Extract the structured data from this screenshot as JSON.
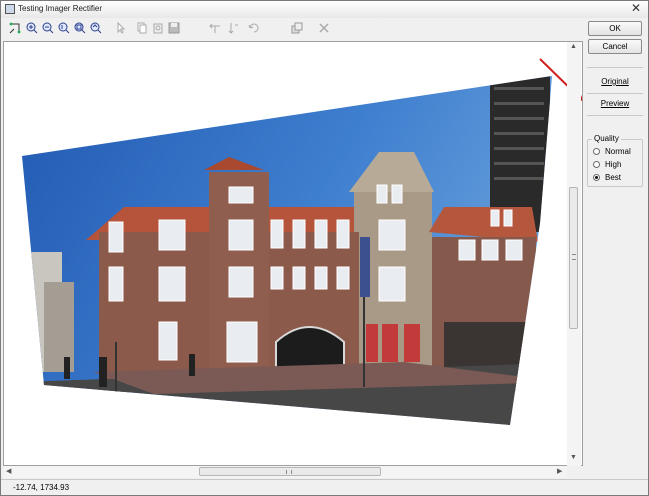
{
  "window": {
    "title": "Testing Imager Rectifier",
    "close_glyph": "✕"
  },
  "toolbar": {
    "tools": [
      {
        "icon": "rectify-pointer-icon"
      },
      {
        "icon": "zoom-in-icon"
      },
      {
        "icon": "zoom-out-icon"
      },
      {
        "icon": "zoom-actual-icon"
      },
      {
        "icon": "zoom-fit-icon"
      },
      {
        "icon": "zoom-selection-icon"
      },
      {
        "icon": "select-arrow-icon"
      },
      {
        "icon": "copy-icon"
      },
      {
        "icon": "paste-icon"
      },
      {
        "icon": "save-icon"
      },
      {
        "icon": "flip-horizontal-icon"
      },
      {
        "icon": "flip-vertical-icon"
      },
      {
        "icon": "rotate-icon"
      },
      {
        "icon": "properties-icon"
      },
      {
        "icon": "delete-icon"
      }
    ]
  },
  "panel": {
    "ok_label": "OK",
    "cancel_label": "Cancel",
    "original_label": "Original",
    "preview_label": "Preview",
    "quality_legend": "Quality",
    "quality_options": [
      {
        "label": "Normal",
        "selected": false
      },
      {
        "label": "High",
        "selected": false
      },
      {
        "label": "Best",
        "selected": true
      }
    ]
  },
  "status": {
    "coords": "-12.74,   1734.93"
  },
  "colors": {
    "annotation_arrow": "#d02020",
    "sky": "#2b63b8",
    "brick": "#8c5a4a"
  }
}
